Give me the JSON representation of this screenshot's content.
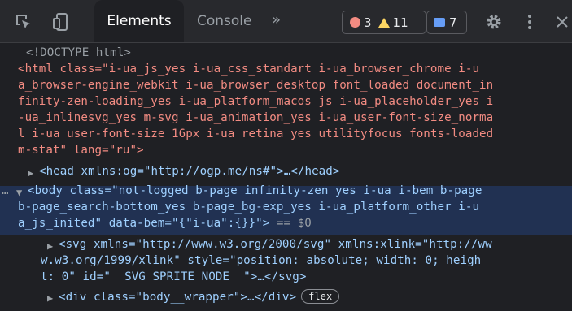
{
  "toolbar": {
    "inspect_icon": "element-picker-icon",
    "device_icon": "device-toggle-icon",
    "tabs": [
      {
        "label": "Elements"
      },
      {
        "label": "Console"
      }
    ],
    "more_label": "»",
    "errors": "3",
    "warnings": "11",
    "messages": "7",
    "colors": {
      "error": "#f28b82",
      "warning": "#fdd663",
      "message": "#669df6"
    }
  },
  "code": {
    "doctype": "<!DOCTYPE html>",
    "html_lines": [
      "<html class=\"i-ua_js_yes i-ua_css_standart i-ua_browser_chrome i-u",
      "a_browser-engine_webkit i-ua_browser_desktop font_loaded document_in",
      "finity-zen-loading_yes i-ua_platform_macos js i-ua_placeholder_yes i",
      "-ua_inlinesvg_yes m-svg i-ua_animation_yes i-ua_user-font-size_norma",
      "l i-ua_user-font-size_16px i-ua_retina_yes utilityfocus fonts-loaded",
      "m-stat\" lang=\"ru\">"
    ],
    "head_line": "<head xmlns:og=\"http://ogp.me/ns#\">…</head>",
    "body_lines": [
      "<body class=\"not-logged b-page_infinity-zen_yes i-ua i-bem b-page",
      "b-page_search-bottom_yes b-page_bg-exp_yes i-ua_platform_other i-u",
      "a_js_inited\" data-bem=\"{\"i-ua\":{}}\">"
    ],
    "body_suffix": " == $0",
    "dots": "…",
    "svg_lines": [
      "<svg xmlns=\"http://www.w3.org/2000/svg\" xmlns:xlink=\"http://ww",
      "w.w3.org/1999/xlink\" style=\"position: absolute; width: 0; heigh",
      "t: 0\" id=\"__SVG_SPRITE_NODE__\">…</svg>"
    ],
    "div_line": "<div class=\"body__wrapper\">…</div>",
    "flex_badge": "flex"
  }
}
